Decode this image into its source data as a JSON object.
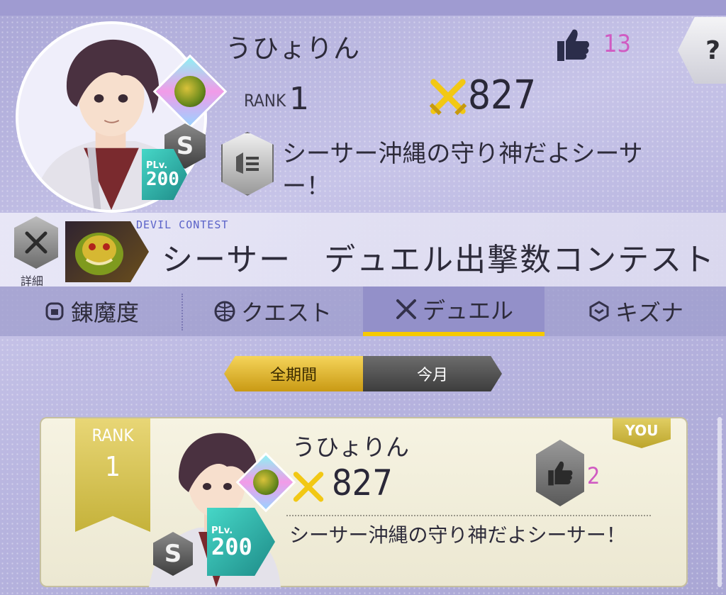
{
  "profile": {
    "name": "うひょりん",
    "rank_label": "RANK",
    "rank_value": "1",
    "power": "827",
    "likes": "13",
    "comment": "シーサー沖縄の守り神だよシーサー！",
    "rank_grade": "S",
    "plv_label": "PLv.",
    "plv_value": "200"
  },
  "help": {
    "label": "?"
  },
  "contest": {
    "eyebrow": "DEVIL CONTEST",
    "title": "シーサー　デュエル出撃数コンテスト",
    "detail_label": "詳細"
  },
  "tabs": [
    {
      "label": "錬魔度",
      "icon": "helmet-icon",
      "active": false
    },
    {
      "label": "クエスト",
      "icon": "globe-icon",
      "active": false
    },
    {
      "label": "デュエル",
      "icon": "swords-icon",
      "active": true
    },
    {
      "label": "キズナ",
      "icon": "bond-icon",
      "active": false
    }
  ],
  "period": {
    "all_label": "全期間",
    "month_label": "今月",
    "selected": "全期間"
  },
  "ranking_card": {
    "rank_label": "RANK",
    "rank_value": "1",
    "you_label": "YOU",
    "name": "うひょりん",
    "power": "827",
    "likes": "2",
    "comment": "シーサー沖縄の守り神だよシーサー！",
    "rank_grade": "S",
    "plv_label": "PLv.",
    "plv_value": "200"
  },
  "colors": {
    "background": "#b7b4df",
    "accent_gold": "#f6c900",
    "like_count": "#d05bc2",
    "plv_teal": "#2ab3aa",
    "card_bg": "#f6f3e2"
  }
}
